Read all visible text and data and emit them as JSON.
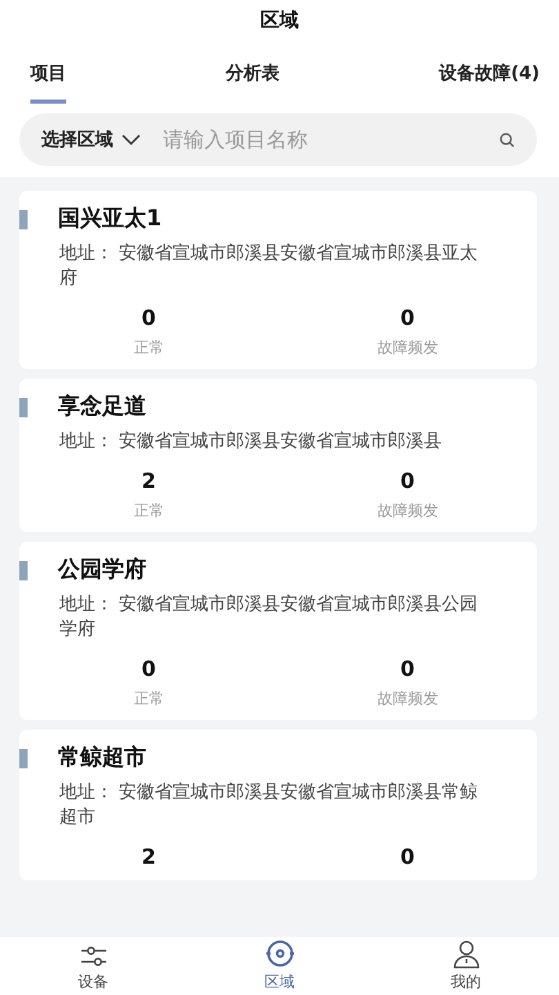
{
  "header": {
    "title": "区域"
  },
  "tabs": [
    {
      "label": "项目",
      "selected": true
    },
    {
      "label": "分析表",
      "selected": false
    },
    {
      "label": "设备故障(4)",
      "selected": false
    }
  ],
  "search": {
    "region_select": "选择区域",
    "placeholder": "请输入项目名称"
  },
  "projects": [
    {
      "name": "国兴亚太1",
      "address": "地址：  安徽省宣城市郎溪县安徽省宣城市郎溪县亚太府",
      "stats": [
        {
          "value": "0",
          "label": "正常"
        },
        {
          "value": "0",
          "label": "故障频发"
        }
      ]
    },
    {
      "name": "享念足道",
      "address": "地址：  安徽省宣城市郎溪县安徽省宣城市郎溪县",
      "stats": [
        {
          "value": "2",
          "label": "正常"
        },
        {
          "value": "0",
          "label": "故障频发"
        }
      ]
    },
    {
      "name": "公园学府",
      "address": "地址：  安徽省宣城市郎溪县安徽省宣城市郎溪县公园学府",
      "stats": [
        {
          "value": "0",
          "label": "正常"
        },
        {
          "value": "0",
          "label": "故障频发"
        }
      ]
    },
    {
      "name": "常鲸超市",
      "address": "地址：  安徽省宣城市郎溪县安徽省宣城市郎溪县常鲸超市",
      "stats": [
        {
          "value": "2"
        },
        {
          "value": "0"
        }
      ]
    }
  ],
  "nav": [
    {
      "label": "设备",
      "selected": false
    },
    {
      "label": "区域",
      "selected": true
    },
    {
      "label": "我的",
      "selected": false
    }
  ]
}
